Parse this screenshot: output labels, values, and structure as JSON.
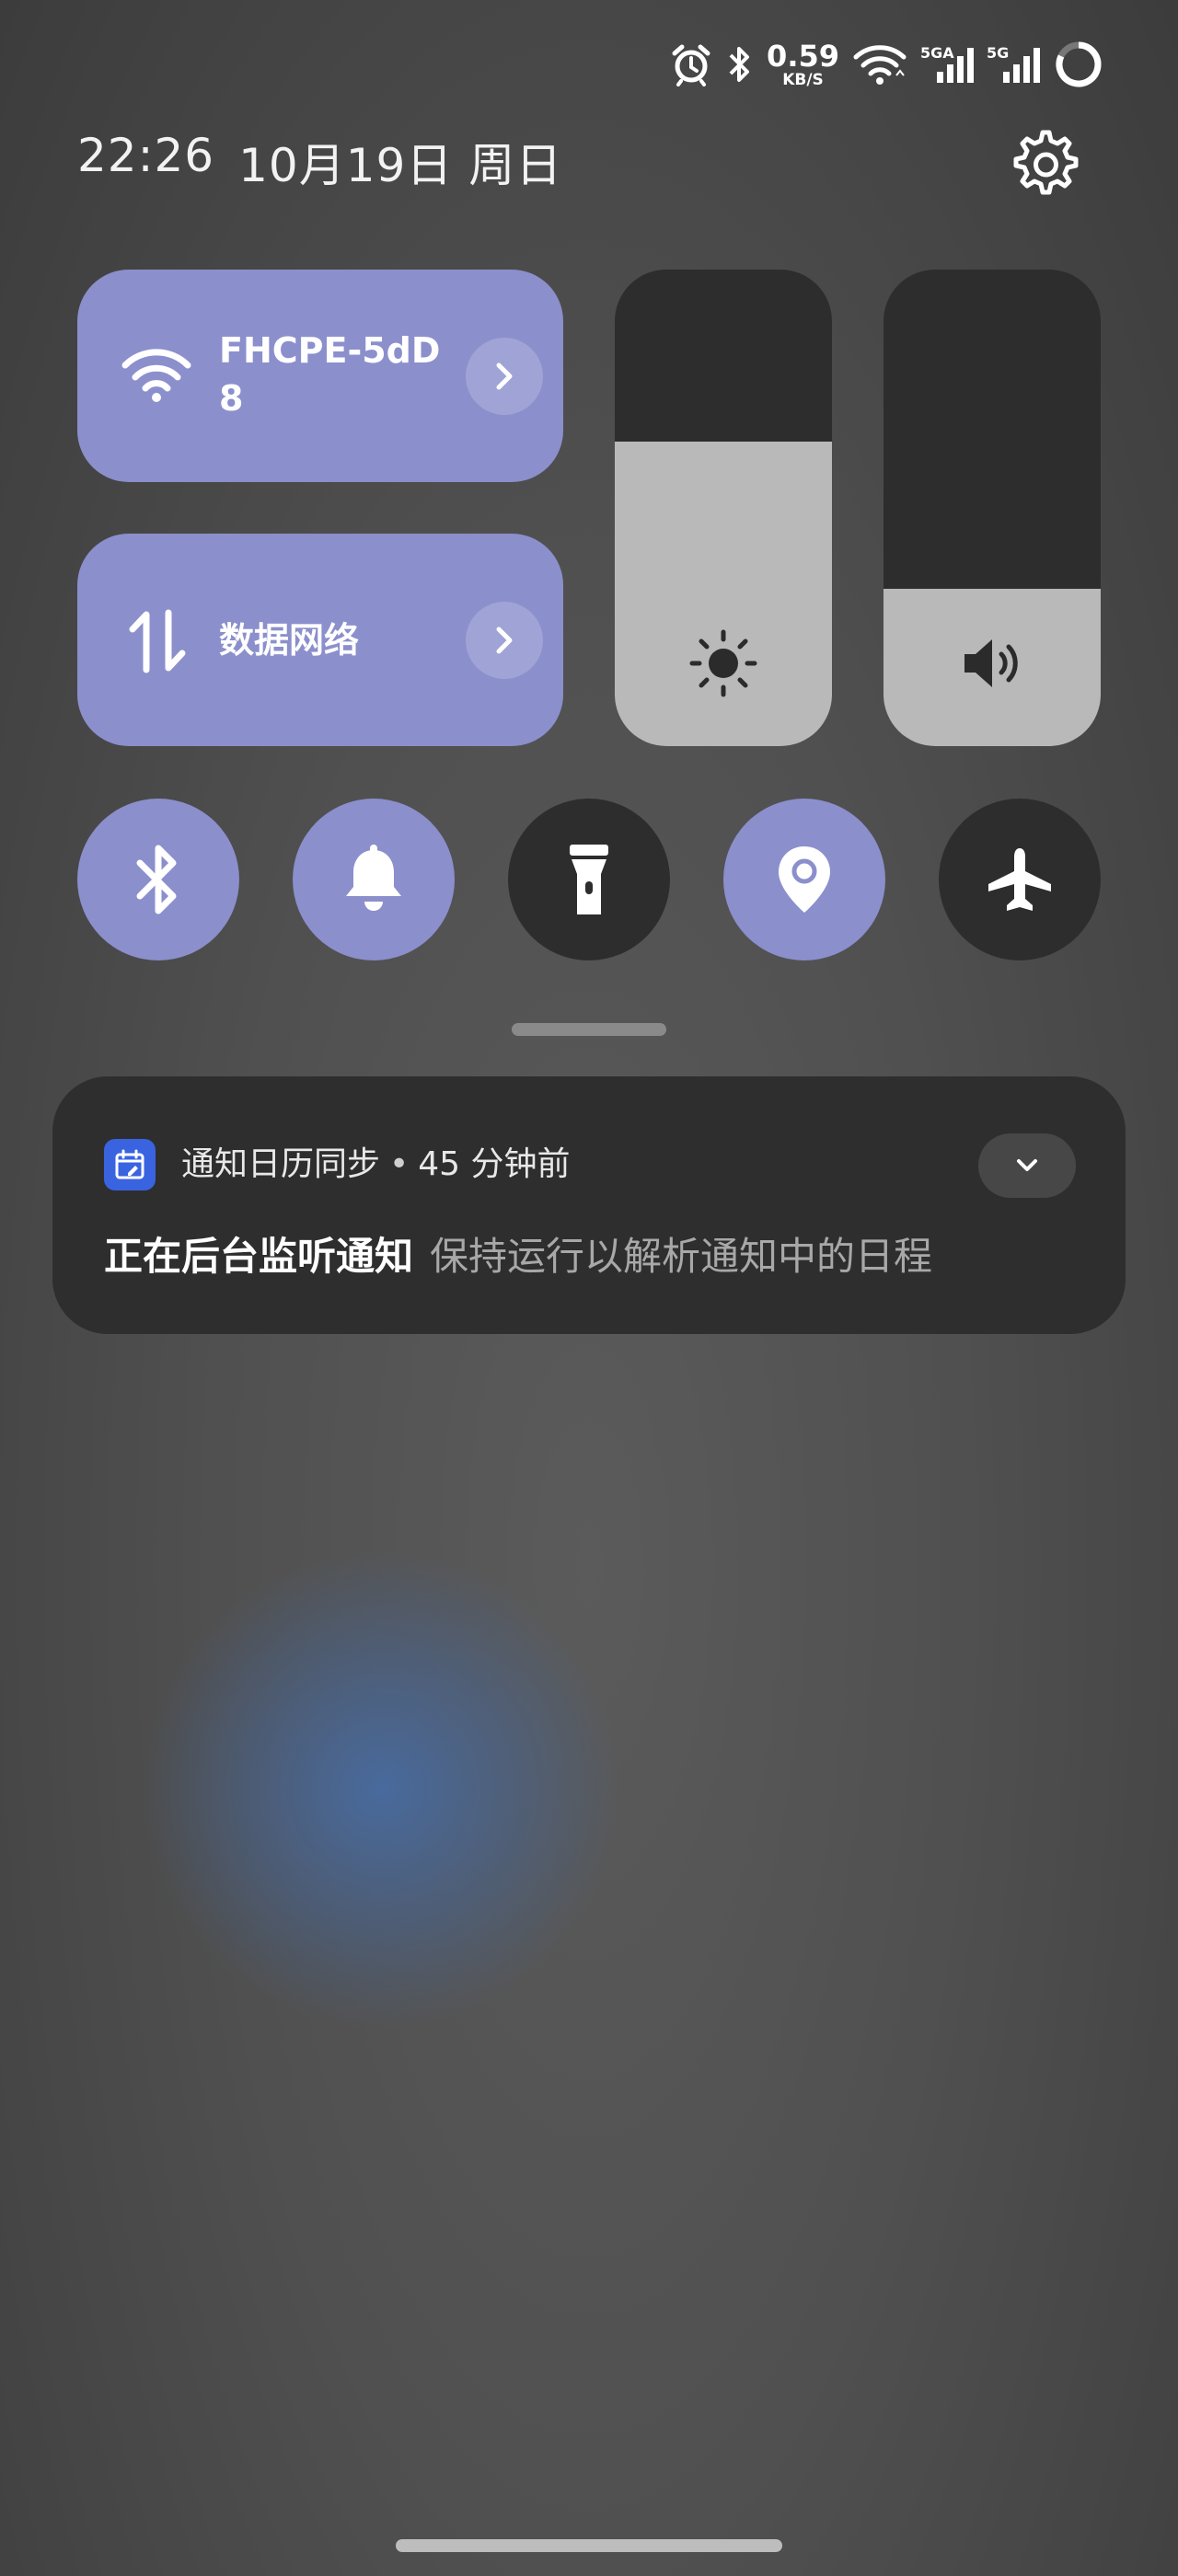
{
  "status_bar": {
    "net_speed": "0.59",
    "net_unit": "KB/S",
    "sim1_label": "5GA",
    "sim2_label": "5G",
    "icons": [
      "alarm-icon",
      "bluetooth-icon",
      "wifi-icon",
      "signal-icon",
      "signal-icon",
      "battery-ring-icon"
    ]
  },
  "header": {
    "time": "22:26",
    "date": "10月19日",
    "weekday": "周日"
  },
  "tiles": {
    "wifi": {
      "label": "FHCPE-5dD\n8",
      "line1": "FHCPE-5dD",
      "line2": "8",
      "active": true
    },
    "data": {
      "label": "数据网络",
      "active": true
    }
  },
  "sliders": {
    "brightness": {
      "level": 0.64
    },
    "volume": {
      "level": 0.33
    }
  },
  "toggles": [
    {
      "name": "bluetooth",
      "active": true
    },
    {
      "name": "ring",
      "active": true
    },
    {
      "name": "flashlight",
      "active": false
    },
    {
      "name": "location",
      "active": true
    },
    {
      "name": "airplane",
      "active": false
    }
  ],
  "notification": {
    "app_name": "通知日历同步",
    "separator": "•",
    "time_ago": "45 分钟前",
    "title": "正在后台监听通知",
    "text": "保持运行以解析通知中的日程"
  },
  "colors": {
    "accent": "#8b8fcc",
    "tile_off": "#2d2d2d",
    "slider_fill": "#b9b9b9",
    "app_icon": "#3a63e0"
  }
}
